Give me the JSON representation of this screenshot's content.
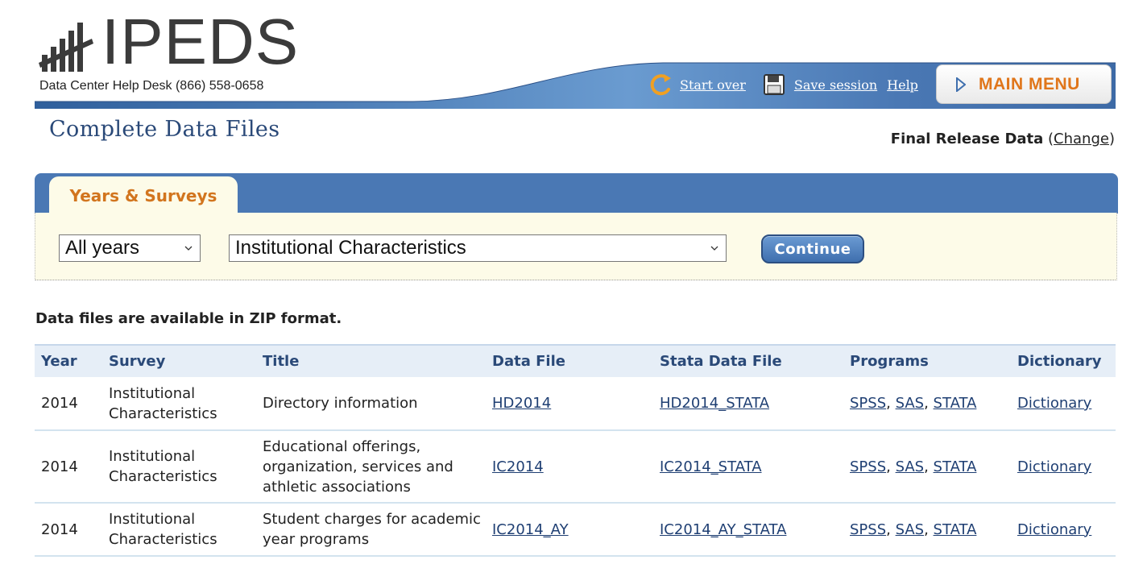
{
  "header": {
    "logo_text": "IPEDS",
    "helpdesk": "Data Center Help Desk (866) 558-0658",
    "links": {
      "start_over": "Start over",
      "save_session": "Save session",
      "help": "Help"
    },
    "main_menu": "MAIN MENU"
  },
  "page": {
    "title": "Complete Data Files",
    "release_label": "Final Release Data",
    "change_link": "Change"
  },
  "panel": {
    "tab_label": "Years & Surveys",
    "years_select": "All years",
    "survey_select": "Institutional Characteristics",
    "continue_label": "Continue"
  },
  "info_text": "Data files are available in ZIP format.",
  "table": {
    "headers": [
      "Year",
      "Survey",
      "Title",
      "Data File",
      "Stata Data File",
      "Programs",
      "Dictionary"
    ],
    "rows": [
      {
        "year": "2014",
        "survey": "Institutional Characteristics",
        "title": "Directory information",
        "data_file": "HD2014",
        "stata_file": "HD2014_STATA",
        "programs": [
          "SPSS",
          "SAS",
          "STATA"
        ],
        "dictionary": "Dictionary"
      },
      {
        "year": "2014",
        "survey": "Institutional Characteristics",
        "title": "Educational offerings, organization, services and athletic associations",
        "data_file": "IC2014",
        "stata_file": "IC2014_STATA",
        "programs": [
          "SPSS",
          "SAS",
          "STATA"
        ],
        "dictionary": "Dictionary"
      },
      {
        "year": "2014",
        "survey": "Institutional Characteristics",
        "title": "Student charges for academic year programs",
        "data_file": "IC2014_AY",
        "stata_file": "IC2014_AY_STATA",
        "programs": [
          "SPSS",
          "SAS",
          "STATA"
        ],
        "dictionary": "Dictionary"
      }
    ]
  },
  "colors": {
    "header_blue": "#4a78b4",
    "title_blue": "#2a4978",
    "orange_accent": "#d2751e",
    "panel_bg": "#fdfbe8",
    "link_blue": "#1f3f73"
  },
  "icons": [
    "ipeds-logo-icon",
    "refresh-icon",
    "floppy-disk-icon",
    "play-triangle-icon",
    "chevron-down-icon"
  ]
}
